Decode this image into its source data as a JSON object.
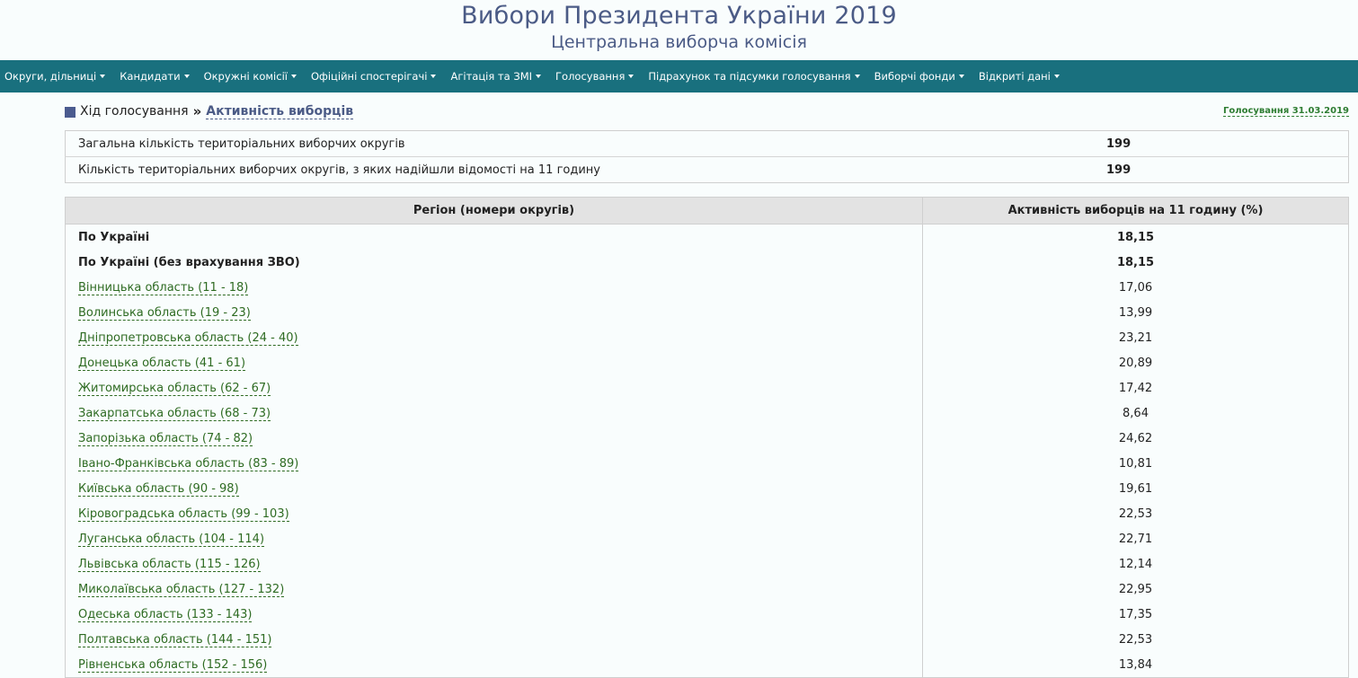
{
  "header": {
    "title": "Вибори Президента України 2019",
    "subtitle": "Центральна виборча комісія"
  },
  "nav": [
    {
      "label": "Округи, дільниці"
    },
    {
      "label": "Кандидати"
    },
    {
      "label": "Окружні комісії"
    },
    {
      "label": "Офіційні спостерігачі"
    },
    {
      "label": "Агітація та ЗМІ"
    },
    {
      "label": "Голосування"
    },
    {
      "label": "Підрахунок та підсумки голосування"
    },
    {
      "label": "Виборчі фонди"
    },
    {
      "label": "Відкриті дані"
    }
  ],
  "breadcrumb": {
    "parent": "Хід голосування",
    "separator": "»",
    "current": "Активність виборців",
    "date_link": "Голосування 31.03.2019"
  },
  "summary": [
    {
      "label": "Загальна кількість територіальних виборчих округів",
      "value": "199"
    },
    {
      "label": "Кількість територіальних виборчих округів, з яких надійшли відомості на 11 годину",
      "value": "199"
    }
  ],
  "table": {
    "col_region": "Регіон (номери округів)",
    "col_turnout": "Активність виборців на 11 годину (%)",
    "totals": [
      {
        "name": "По Україні",
        "value": "18,15"
      },
      {
        "name": "По Україні (без врахування ЗВО)",
        "value": "18,15"
      }
    ],
    "rows": [
      {
        "name": "Вінницька область (11 - 18)",
        "value": "17,06"
      },
      {
        "name": "Волинська область (19 - 23)",
        "value": "13,99"
      },
      {
        "name": "Дніпропетровська область (24 - 40)",
        "value": "23,21"
      },
      {
        "name": "Донецька область (41 - 61)",
        "value": "20,89"
      },
      {
        "name": "Житомирська область (62 - 67)",
        "value": "17,42"
      },
      {
        "name": "Закарпатська область (68 - 73)",
        "value": "8,64"
      },
      {
        "name": "Запорізька область (74 - 82)",
        "value": "24,62"
      },
      {
        "name": "Івано-Франківська область (83 - 89)",
        "value": "10,81"
      },
      {
        "name": "Київська область (90 - 98)",
        "value": "19,61"
      },
      {
        "name": "Кіровоградська область (99 - 103)",
        "value": "22,53"
      },
      {
        "name": "Луганська область (104 - 114)",
        "value": "22,71"
      },
      {
        "name": "Львівська область (115 - 126)",
        "value": "12,14"
      },
      {
        "name": "Миколаївська область (127 - 132)",
        "value": "22,95"
      },
      {
        "name": "Одеська область (133 - 143)",
        "value": "17,35"
      },
      {
        "name": "Полтавська область (144 - 151)",
        "value": "22,53"
      },
      {
        "name": "Рівненська область (152 - 156)",
        "value": "13,84"
      }
    ]
  }
}
